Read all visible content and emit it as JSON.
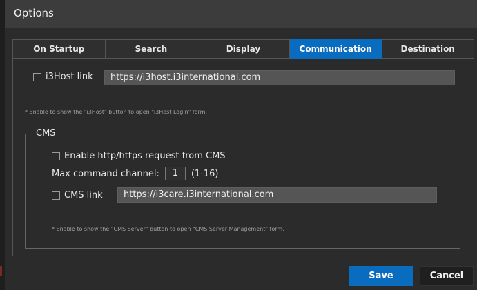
{
  "window": {
    "title": "Options"
  },
  "tabs": [
    {
      "label": "On Startup",
      "active": false
    },
    {
      "label": "Search",
      "active": false
    },
    {
      "label": "Display",
      "active": false
    },
    {
      "label": "Communication",
      "active": true
    },
    {
      "label": "Destination",
      "active": false
    }
  ],
  "i3host": {
    "checkbox_label": "i3Host link",
    "checked": false,
    "url": "https://i3host.i3international.com",
    "note": "* Enable to show the \"i3Host\" button to open \"i3Host Login\" form."
  },
  "cms": {
    "group_label": "CMS",
    "enable_request_label": "Enable http/https request from CMS",
    "enable_request_checked": false,
    "max_channel_label": "Max command channel:",
    "max_channel_value": "1",
    "max_channel_range": "(1-16)",
    "link_label": "CMS link",
    "link_checked": false,
    "url": "https://i3care.i3international.com",
    "note": "* Enable to show the \"CMS Server\" button to open \"CMS Server Management\" form."
  },
  "buttons": {
    "save": "Save",
    "cancel": "Cancel"
  },
  "colors": {
    "accent": "#0a6cbf",
    "background": "#2b2b2b",
    "titlebar": "#3c3c3c"
  }
}
